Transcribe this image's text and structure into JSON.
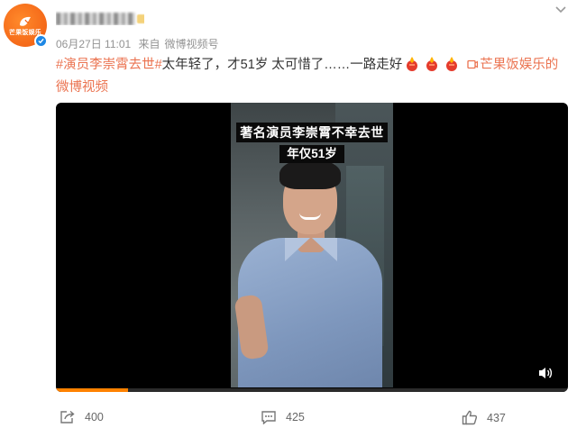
{
  "post": {
    "time": "06月27日 11:01",
    "source_prefix": "来自",
    "source": "微博视频号",
    "topic": "#演员李崇霄去世#",
    "text": "太年轻了，才51岁 太可惜了……一路走好",
    "link_label": "芒果饭娱乐的微博视频"
  },
  "avatar": {
    "logo_text": "芒果饭娱乐",
    "icon": "mango-logo-icon"
  },
  "video": {
    "caption_title": "著名演员李崇霄不幸去世",
    "caption_sub": "年仅51岁",
    "progress": 0.14,
    "progress_color": "#ff8200"
  },
  "actions": {
    "share_count": "400",
    "comment_count": "425",
    "like_count": "437"
  },
  "colors": {
    "accent": "#eb7350",
    "brand": "#ff8200",
    "verified": "#1e88e5"
  }
}
